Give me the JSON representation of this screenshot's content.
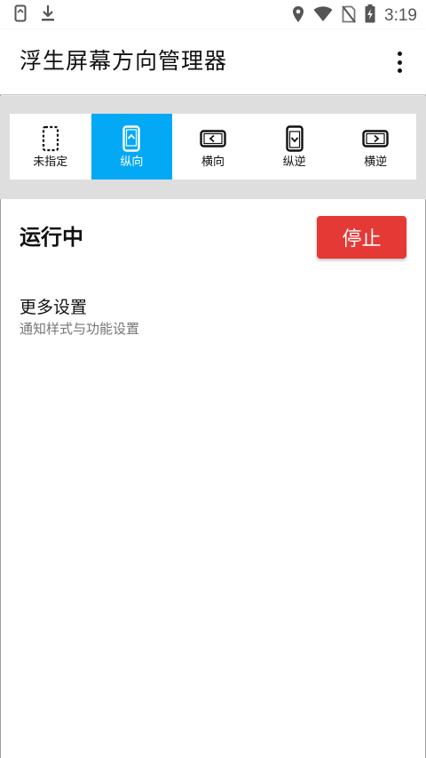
{
  "status_bar": {
    "time": "3:19",
    "left_icons": [
      "screen-rotation-notification-icon",
      "download-icon"
    ],
    "right_icons": [
      "location-icon",
      "wifi-icon",
      "no-sim-icon",
      "battery-charging-icon"
    ]
  },
  "app_bar": {
    "title": "浮生屏幕方向管理器",
    "overflow_icon": "more-vert-icon"
  },
  "orientation_options": [
    {
      "label": "未指定",
      "icon": "unspecified-phone-icon",
      "selected": false
    },
    {
      "label": "纵向",
      "icon": "portrait-phone-icon",
      "selected": true
    },
    {
      "label": "横向",
      "icon": "landscape-phone-icon",
      "selected": false
    },
    {
      "label": "纵逆",
      "icon": "reverse-portrait-phone-icon",
      "selected": false
    },
    {
      "label": "横逆",
      "icon": "reverse-landscape-phone-icon",
      "selected": false
    }
  ],
  "service": {
    "status": "运行中",
    "stop_label": "停止"
  },
  "more_settings": {
    "title": "更多设置",
    "subtitle": "通知样式与功能设置"
  },
  "colors": {
    "selected": "#03a9f4",
    "stop_button": "#e53935",
    "band": "#dedede"
  }
}
